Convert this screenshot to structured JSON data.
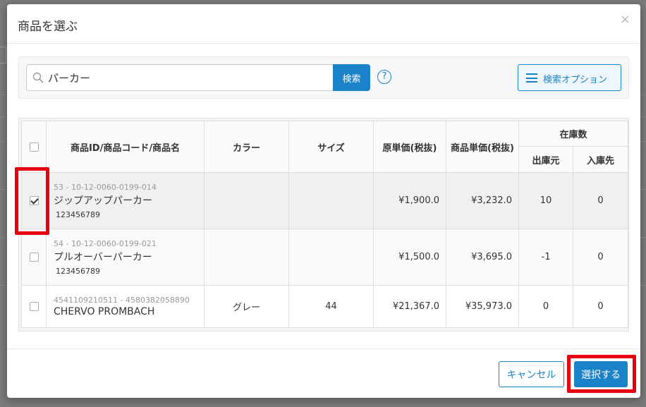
{
  "dialog": {
    "title": "商品を選ぶ",
    "close_label": "×"
  },
  "search": {
    "value": "パーカー",
    "button_label": "検索",
    "help_label": "?",
    "options_label": "検索オプション"
  },
  "table": {
    "headers": {
      "product": "商品ID/商品コード/商品名",
      "color": "カラー",
      "size": "サイズ",
      "cost_price": "原単価(税抜)",
      "unit_price": "商品単価(税抜)",
      "stock": "在庫数",
      "stock_from": "出庫元",
      "stock_to": "入庫先"
    },
    "rows": [
      {
        "checked": true,
        "id": "53 - 10-12-0060-0199-014",
        "name": "ジップアップパーカー",
        "code": "123456789",
        "color": "",
        "size": "",
        "cost_price": "¥1,900.0",
        "unit_price": "¥3,232.0",
        "stock_from": "10",
        "stock_to": "0"
      },
      {
        "checked": false,
        "id": "54 - 10-12-0060-0199-021",
        "name": "プルオーバーパーカー",
        "code": "123456789",
        "color": "",
        "size": "",
        "cost_price": "¥1,500.0",
        "unit_price": "¥3,695.0",
        "stock_from": "-1",
        "stock_to": "0"
      },
      {
        "checked": false,
        "id": "4541109210511 - 4580382058890",
        "name": "CHERVO PROMBACH",
        "code": "",
        "color": "グレー",
        "size": "44",
        "cost_price": "¥21,367.0",
        "unit_price": "¥35,973.0",
        "stock_from": "0",
        "stock_to": "0"
      }
    ]
  },
  "footer": {
    "cancel_label": "キャンセル",
    "select_label": "選択する"
  },
  "colors": {
    "primary": "#1a82c8",
    "highlight": "#e60012"
  }
}
